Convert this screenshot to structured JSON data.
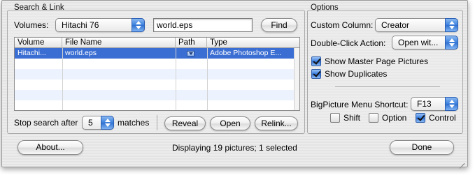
{
  "search_link": {
    "title": "Search & Link",
    "volumes_label": "Volumes:",
    "volume_selected": "Hitachi 76",
    "search_value": "world.eps",
    "find_label": "Find",
    "table": {
      "columns": [
        "Volume",
        "File Name",
        "Path",
        "Type"
      ],
      "rows": [
        {
          "volume": "Hitachi...",
          "file_name": "world.eps",
          "type": "Adobe Photoshop E..."
        }
      ]
    },
    "stop_label": "Stop search after",
    "stop_value": "5",
    "matches_label": "matches",
    "reveal_label": "Reveal",
    "open_label": "Open",
    "relink_label": "Relink..."
  },
  "options": {
    "title": "Options",
    "custom_column_label": "Custom Column:",
    "custom_column_value": "Creator",
    "double_click_label": "Double-Click Action:",
    "double_click_value": "Open wit...",
    "show_master_label": "Show Master Page Pictures",
    "show_master_checked": true,
    "show_duplicates_label": "Show Duplicates",
    "show_duplicates_checked": true,
    "shortcut_label": "BigPicture Menu Shortcut:",
    "shortcut_value": "F13",
    "shift_label": "Shift",
    "shift_checked": false,
    "option_label": "Option",
    "option_checked": false,
    "control_label": "Control",
    "control_checked": true
  },
  "footer": {
    "about_label": "About...",
    "status": "Displaying 19 pictures; 1 selected",
    "done_label": "Done"
  },
  "colors": {
    "selection": "#3b6ed3",
    "accent_blue": "#3a7fde"
  }
}
